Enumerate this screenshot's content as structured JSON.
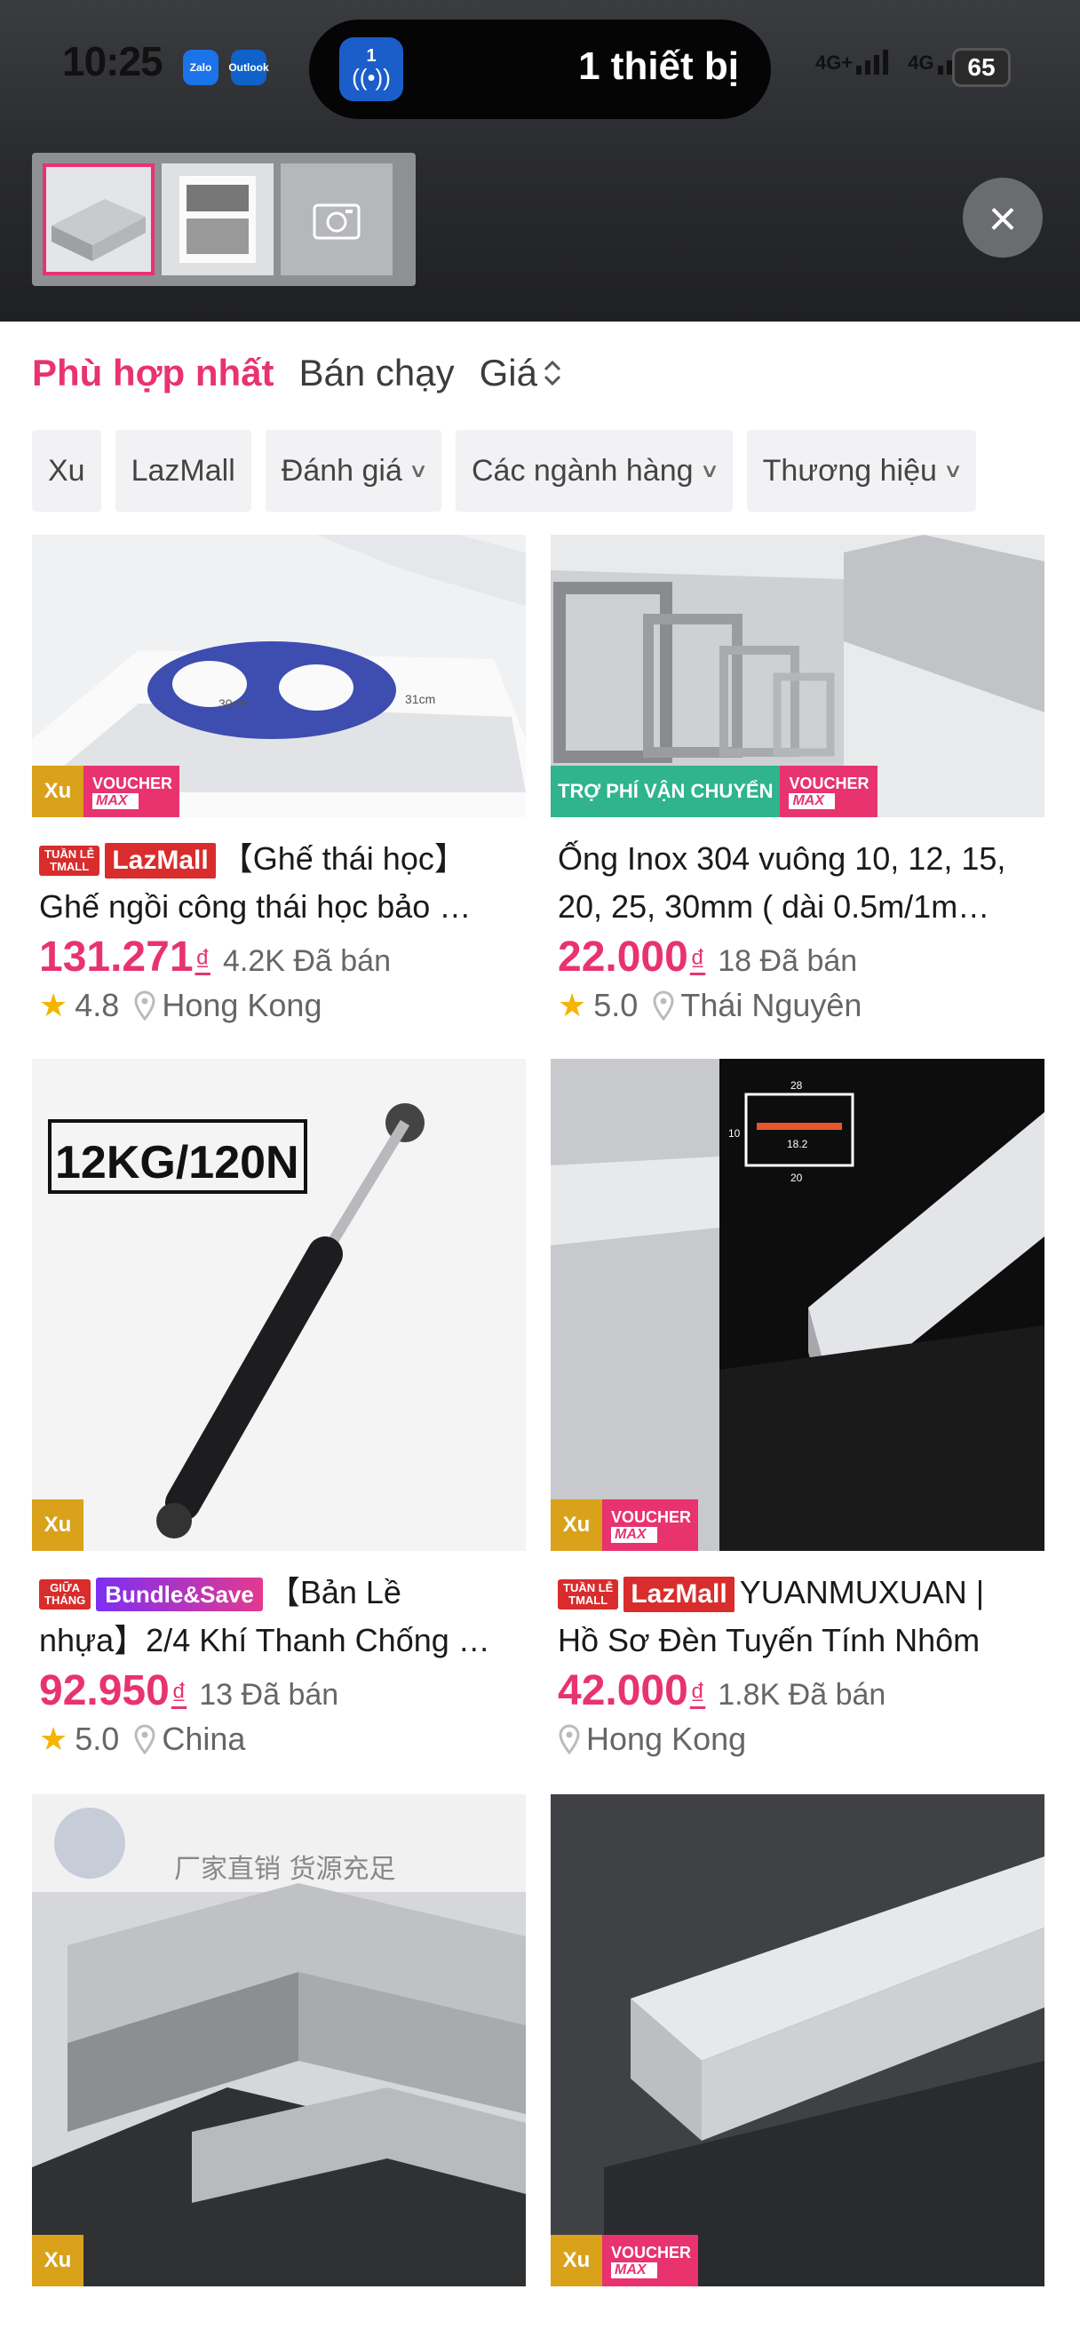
{
  "status_bar": {
    "time": "10:25",
    "apps": [
      "Zalo",
      "Outlook"
    ],
    "island_count": "1",
    "island_text": "1 thiết bị",
    "network1": "4G+",
    "network2": "4G",
    "battery": "65"
  },
  "thumbnails": {
    "items": [
      "aluminum-profile-thumb",
      "product-collage-thumb",
      "camera-icon"
    ]
  },
  "sort": {
    "best": "Phù hợp nhất",
    "sold": "Bán chạy",
    "price": "Giá"
  },
  "filters": [
    {
      "label": "Xu",
      "dropdown": false
    },
    {
      "label": "LazMall",
      "dropdown": false
    },
    {
      "label": "Đánh giá",
      "dropdown": true
    },
    {
      "label": "Các ngành hàng",
      "dropdown": true
    },
    {
      "label": "Thương hiệu",
      "dropdown": true
    }
  ],
  "products": [
    {
      "title_line1": "【Ghế thái học】",
      "title_line2": "Ghế ngồi công thái học bảo …",
      "tags": [
        "TUẦN LỄ TMALL",
        "LazMall"
      ],
      "badges": [
        "Xu",
        "VOUCHER MAX"
      ],
      "price": "131.271",
      "currency": "₫",
      "sold": "4.2K Đã bán",
      "rating": "4.8",
      "location": "Hong Kong",
      "image_label_1": "30cm",
      "image_label_2": "31cm"
    },
    {
      "title_line1": "Ống Inox 304 vuông 10, 12, 15,",
      "title_line2": "20, 25, 30mm ( dài 0.5m/1m…",
      "tags": [],
      "badges": [
        "TRỢ PHÍ VẬN CHUYỂN",
        "VOUCHER MAX"
      ],
      "price": "22.000",
      "currency": "₫",
      "sold": "18 Đã bán",
      "rating": "5.0",
      "location": "Thái Nguyên"
    },
    {
      "title_line1": "【Bản Lề",
      "title_line2": "nhựa】2/4 Khí Thanh Chống …",
      "tags": [
        "GIỮA THÁNG",
        "Bundle&Save"
      ],
      "badges": [
        "Xu"
      ],
      "price": "92.950",
      "currency": "₫",
      "sold": "13 Đã bán",
      "rating": "5.0",
      "location": "China",
      "image_label_1": "12KG/120N"
    },
    {
      "title_line1": "YUANMUXUAN |",
      "title_line2": "Hồ Sơ Đèn Tuyến Tính Nhôm",
      "tags": [
        "TUẦN LỄ TMALL",
        "LazMall"
      ],
      "badges": [
        "Xu",
        "VOUCHER MAX"
      ],
      "price": "42.000",
      "currency": "₫",
      "sold": "1.8K Đã bán",
      "rating": "",
      "location": "Hong Kong",
      "image_dims": [
        "28",
        "10",
        "18.2",
        "20"
      ]
    },
    {
      "badges": [
        "Xu"
      ],
      "image_label_1": "厂家直销 货源充足"
    },
    {
      "badges": [
        "Xu",
        "VOUCHER MAX"
      ]
    }
  ],
  "colors": {
    "accent": "#e8336f",
    "xu": "#d9a21a",
    "lazmall": "#d92c2c",
    "ship": "#2fb48d"
  }
}
